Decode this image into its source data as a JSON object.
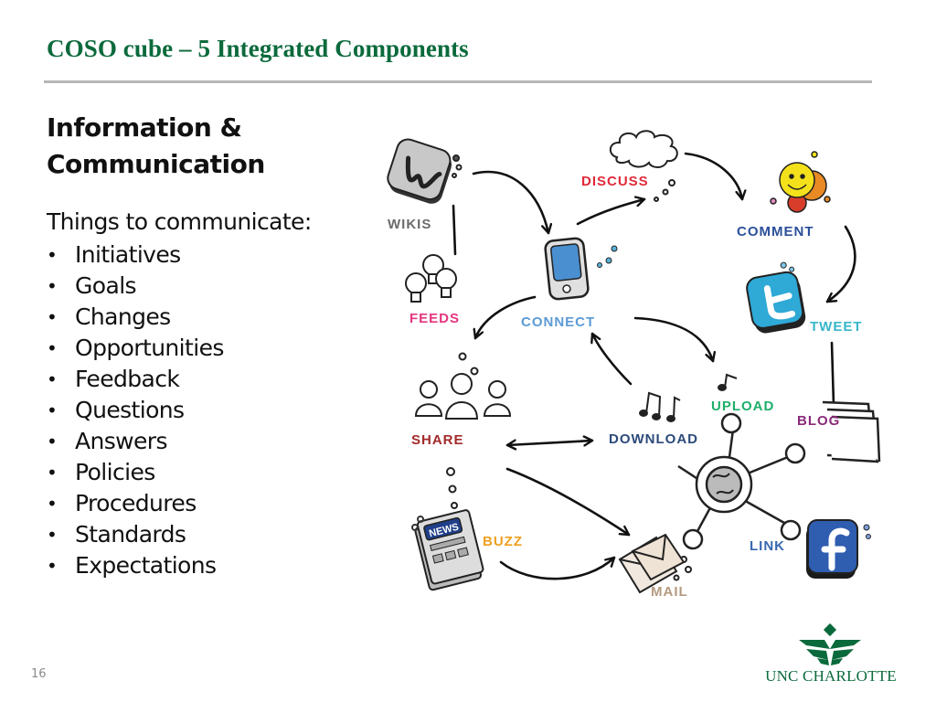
{
  "slide": {
    "title": "COSO cube – 5 Integrated Components",
    "heading": "Information & Communication",
    "intro": "Things to communicate:",
    "bullets": [
      "Initiatives",
      "Goals",
      "Changes",
      "Opportunities",
      "Feedback",
      "Questions",
      "Answers",
      "Policies",
      "Procedures",
      "Standards",
      "Expectations"
    ],
    "bullet_glyph": "•",
    "page_number": "16"
  },
  "diagram": {
    "labels": {
      "wikis": "WIKIS",
      "discuss": "DISCUSS",
      "comment": "COMMENT",
      "feeds": "FEEDS",
      "connect": "CONNECT",
      "tweet": "TWEET",
      "share": "SHARE",
      "download": "DOWNLOAD",
      "upload": "UPLOAD",
      "blog": "BLOG",
      "buzz": "BUZZ",
      "link": "LINK",
      "mail": "MAIL",
      "news": "NEWS"
    },
    "colors": {
      "wikis": "#6b6b6b",
      "discuss": "#e02a3a",
      "comment": "#2b4f9a",
      "feeds": "#e4357f",
      "connect": "#5b9bd5",
      "tweet": "#38b6c9",
      "share": "#a32a2a",
      "download": "#2c4a7a",
      "upload": "#1fae6a",
      "blog": "#8a2a7a",
      "buzz": "#f0a020",
      "link": "#3a68b0",
      "mail": "#b59a80"
    }
  },
  "logo": {
    "text": "UNC CHARLOTTE",
    "color": "#0b6a3c"
  }
}
